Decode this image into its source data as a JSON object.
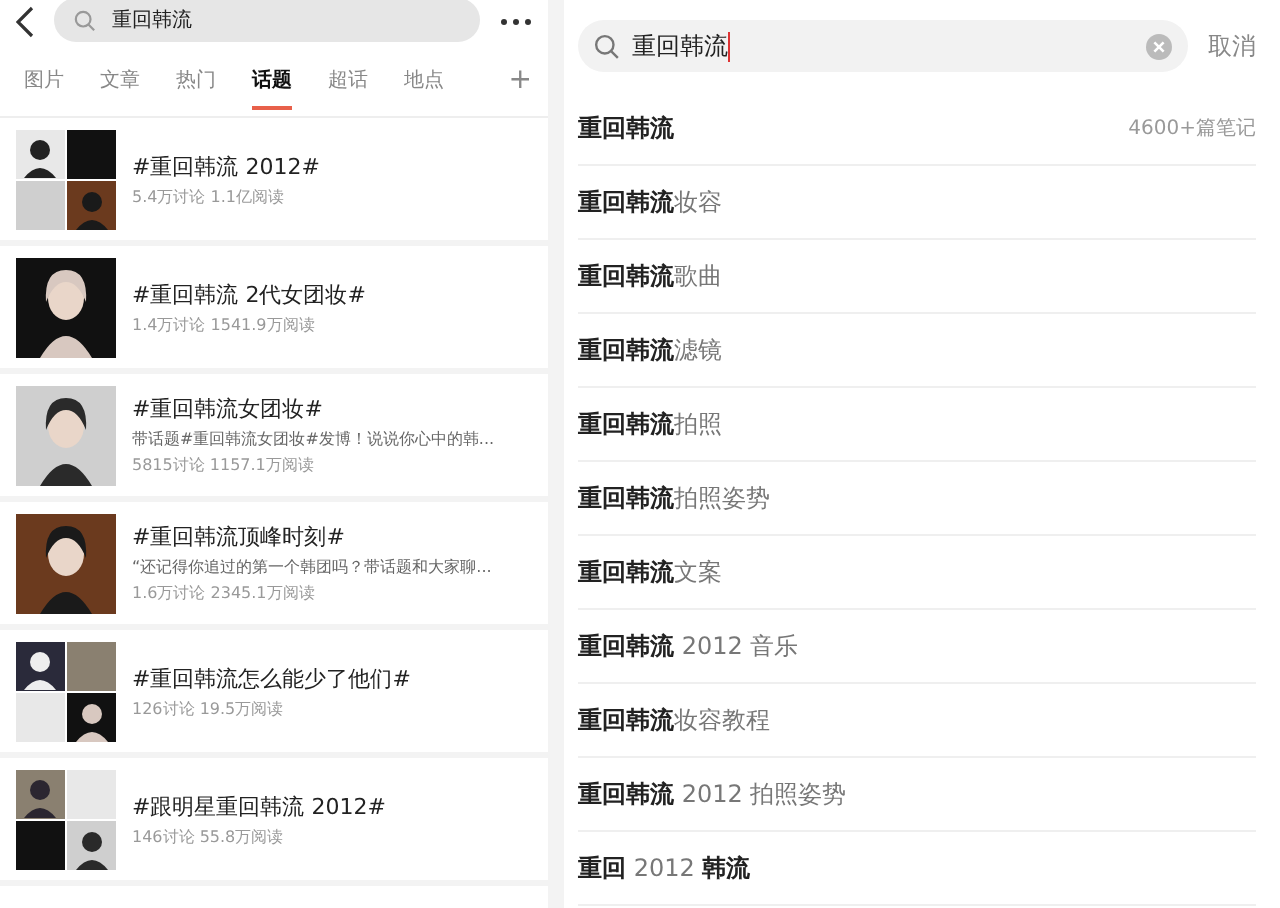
{
  "left": {
    "search": {
      "value": "重回韩流"
    },
    "tabs": [
      {
        "label": "图片",
        "selected": false
      },
      {
        "label": "文章",
        "selected": false
      },
      {
        "label": "热门",
        "selected": false
      },
      {
        "label": "话题",
        "selected": true
      },
      {
        "label": "超话",
        "selected": false
      },
      {
        "label": "地点",
        "selected": false
      }
    ],
    "add_tab": "+",
    "topics": [
      {
        "title": "#重回韩流 2012#",
        "stats": "5.4万讨论 1.1亿阅读"
      },
      {
        "title": "#重回韩流 2代女团妆#",
        "stats": "1.4万讨论 1541.9万阅读"
      },
      {
        "title": "#重回韩流女团妆#",
        "desc": "带话题#重回韩流女团妆#发博！说说你心中的韩...",
        "stats": "5815讨论 1157.1万阅读"
      },
      {
        "title": "#重回韩流顶峰时刻#",
        "desc": "“还记得你追过的第一个韩团吗？带话题和大家聊...",
        "stats": "1.6万讨论 2345.1万阅读"
      },
      {
        "title": "#重回韩流怎么能少了他们#",
        "stats": "126讨论 19.5万阅读"
      },
      {
        "title": "#跟明星重回韩流 2012#",
        "stats": "146讨论 55.8万阅读"
      }
    ]
  },
  "right": {
    "search": {
      "value": "重回韩流"
    },
    "cancel": "取消",
    "suggestions": [
      {
        "text": "**重回韩流**",
        "count": "4600+篇笔记"
      },
      {
        "text": "**重回韩流**妆容"
      },
      {
        "text": "**重回韩流**歌曲"
      },
      {
        "text": "**重回韩流**滤镜"
      },
      {
        "text": "**重回韩流**拍照"
      },
      {
        "text": "**重回韩流**拍照姿势"
      },
      {
        "text": "**重回韩流**文案"
      },
      {
        "text": "**重回韩流** 2012 音乐"
      },
      {
        "text": "**重回韩流**妆容教程"
      },
      {
        "text": "**重回韩流** 2012 拍照姿势"
      },
      {
        "text": "**重回** 2012 **韩流**"
      }
    ]
  }
}
